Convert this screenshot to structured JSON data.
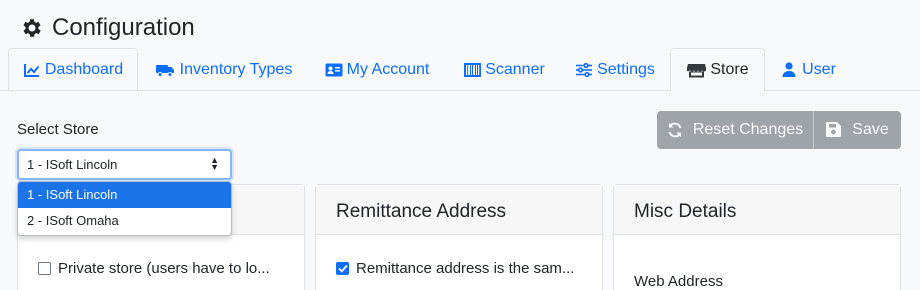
{
  "page": {
    "title": "Configuration"
  },
  "tabs": [
    {
      "label": "Dashboard",
      "icon": "chart-line-icon"
    },
    {
      "label": "Inventory Types",
      "icon": "truck-icon"
    },
    {
      "label": "My Account",
      "icon": "id-card-icon"
    },
    {
      "label": "Scanner",
      "icon": "barcode-icon"
    },
    {
      "label": "Settings",
      "icon": "sliders-icon"
    },
    {
      "label": "Store",
      "icon": "store-icon"
    },
    {
      "label": "User",
      "icon": "user-icon"
    }
  ],
  "active_tab": "Store",
  "store_select": {
    "label": "Select Store",
    "selected": "1 - ISoft Lincoln",
    "options": [
      "1 - ISoft Lincoln",
      "2 - ISoft Omaha"
    ]
  },
  "actions": {
    "reset_label": "Reset Changes",
    "save_label": "Save"
  },
  "cards": {
    "store": {
      "checkbox_label": "Private store (users have to lo...",
      "checked": false
    },
    "remittance": {
      "title": "Remittance Address",
      "checkbox_label": "Remittance address is the sam...",
      "checked": true
    },
    "misc": {
      "title": "Misc Details",
      "field_label": "Web Address"
    }
  },
  "colors": {
    "accent": "#0d6efd",
    "selection": "#1a73e8",
    "button_disabled": "#9fa4a9"
  }
}
